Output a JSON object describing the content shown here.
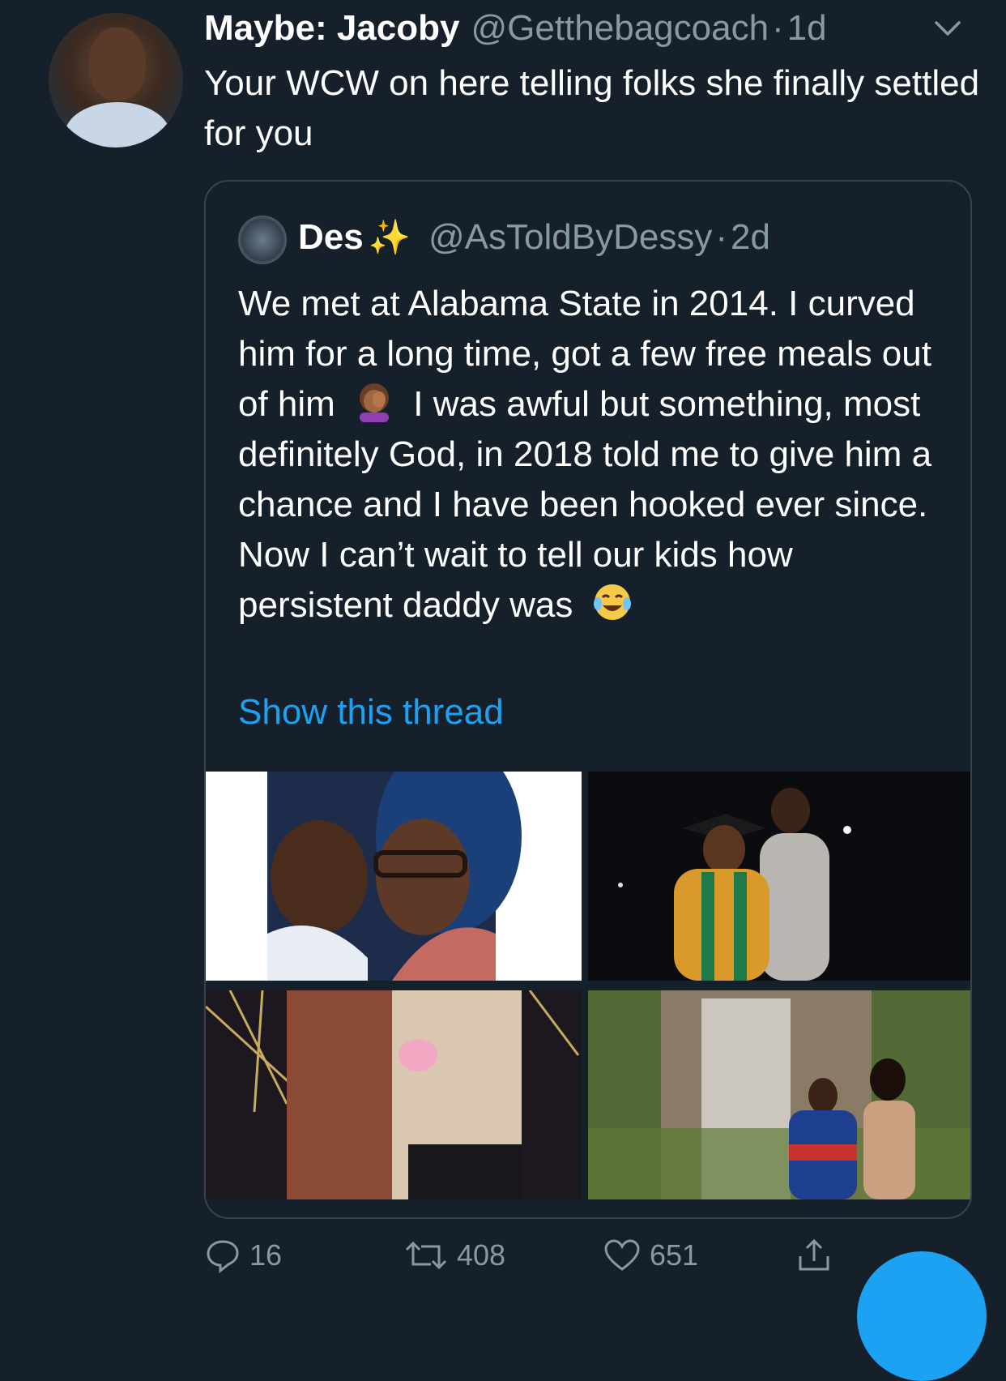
{
  "tweet": {
    "display_name": "Maybe: Jacoby",
    "handle": "@Getthebagcoach",
    "separator": "·",
    "time": "1d",
    "text": "Your WCW on here telling folks she finally settled for you"
  },
  "quoted_tweet": {
    "display_name": "Des",
    "name_emoji": "✨",
    "handle": "@AsToldByDessy",
    "separator": "·",
    "time": "2d",
    "text_part1": "We met at Alabama State in 2014. I curved him for a long time, got a few free meals out of him",
    "emoji1": "facepalm-emoji",
    "text_part2": "I was awful but something, most definitely God, in 2018 told me to give him a chance and I have been hooked ever since. Now I can’t wait to tell our kids how persistent daddy was",
    "emoji2": "tears-of-joy-emoji",
    "show_thread": "Show this thread",
    "media": [
      {
        "name": "couple-selfie-photo"
      },
      {
        "name": "graduation-photo"
      },
      {
        "name": "fair-hug-photo"
      },
      {
        "name": "waterfall-photo"
      }
    ]
  },
  "actions": {
    "replies": "16",
    "retweets": "408",
    "likes": "651"
  },
  "colors": {
    "background": "#15202b",
    "secondary_text": "#8899a6",
    "link": "#1da1f2",
    "border": "#38444d"
  }
}
